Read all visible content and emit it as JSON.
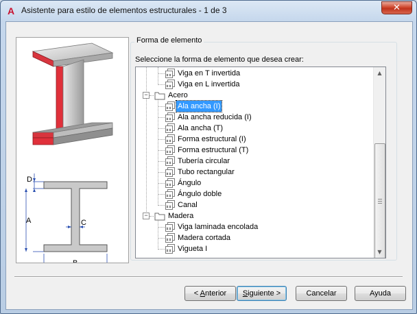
{
  "window": {
    "title": "Asistente para estilo de elementos estructurales - 1 de 3",
    "app_icon": "A",
    "close_label": "✕"
  },
  "group": {
    "title": "Forma de elemento",
    "prompt": "Seleccione la forma de elemento que desea crear:"
  },
  "image": {
    "dimension_labels": {
      "d": "D",
      "a": "A",
      "c": "C",
      "b": "B"
    },
    "flange_color": "#e0303a"
  },
  "tree": {
    "items": [
      {
        "label": "Viga en T invertida",
        "level": 2,
        "type": "item"
      },
      {
        "label": "Viga en L invertida",
        "level": 2,
        "type": "item"
      },
      {
        "label": "Acero",
        "level": 1,
        "type": "folder",
        "expanded": true
      },
      {
        "label": "Ala ancha (I)",
        "level": 2,
        "type": "item",
        "selected": true
      },
      {
        "label": "Ala ancha reducida (I)",
        "level": 2,
        "type": "item"
      },
      {
        "label": "Ala ancha (T)",
        "level": 2,
        "type": "item"
      },
      {
        "label": "Forma estructural (I)",
        "level": 2,
        "type": "item"
      },
      {
        "label": "Forma estructural (T)",
        "level": 2,
        "type": "item"
      },
      {
        "label": "Tubería circular",
        "level": 2,
        "type": "item"
      },
      {
        "label": "Tubo rectangular",
        "level": 2,
        "type": "item"
      },
      {
        "label": "Ángulo",
        "level": 2,
        "type": "item"
      },
      {
        "label": "Ángulo doble",
        "level": 2,
        "type": "item"
      },
      {
        "label": "Canal",
        "level": 2,
        "type": "item"
      },
      {
        "label": "Madera",
        "level": 1,
        "type": "folder",
        "expanded": true
      },
      {
        "label": "Viga laminada encolada",
        "level": 2,
        "type": "item"
      },
      {
        "label": "Madera cortada",
        "level": 2,
        "type": "item"
      },
      {
        "label": "Vigueta I",
        "level": 2,
        "type": "item"
      }
    ],
    "expander_symbol": "−"
  },
  "buttons": {
    "back": {
      "pre": "< ",
      "mnemonic": "A",
      "post": "nterior"
    },
    "next": {
      "pre": "",
      "mnemonic": "S",
      "post": "iguiente >"
    },
    "cancel": "Cancelar",
    "help": "Ayuda"
  }
}
